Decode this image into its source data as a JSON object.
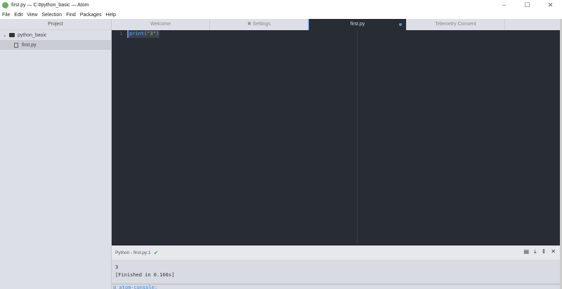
{
  "window": {
    "title": "first.py — C:#python_basic — Atom",
    "minimize": "–",
    "maximize": "☐",
    "close": "✕"
  },
  "menu": [
    "File",
    "Edit",
    "View",
    "Selection",
    "Find",
    "Packages",
    "Help"
  ],
  "sidebar": {
    "header": "Project",
    "folder": "python_basic",
    "file": "first.py"
  },
  "tabs": [
    {
      "label": "Welcome"
    },
    {
      "label": "Settings",
      "icon": "✖"
    },
    {
      "label": "first.py"
    },
    {
      "label": "Telemetry Consent"
    }
  ],
  "editor": {
    "line_number": "1",
    "code_fn": "print",
    "code_open": "(",
    "code_str": "\"3\"",
    "code_close": ")"
  },
  "panel": {
    "title": "Python - first.py:1",
    "check": "✔",
    "output_line1": "3",
    "output_line2": "[Finished in 0.166s]",
    "bottom_text": "⊡ atom-console:"
  }
}
